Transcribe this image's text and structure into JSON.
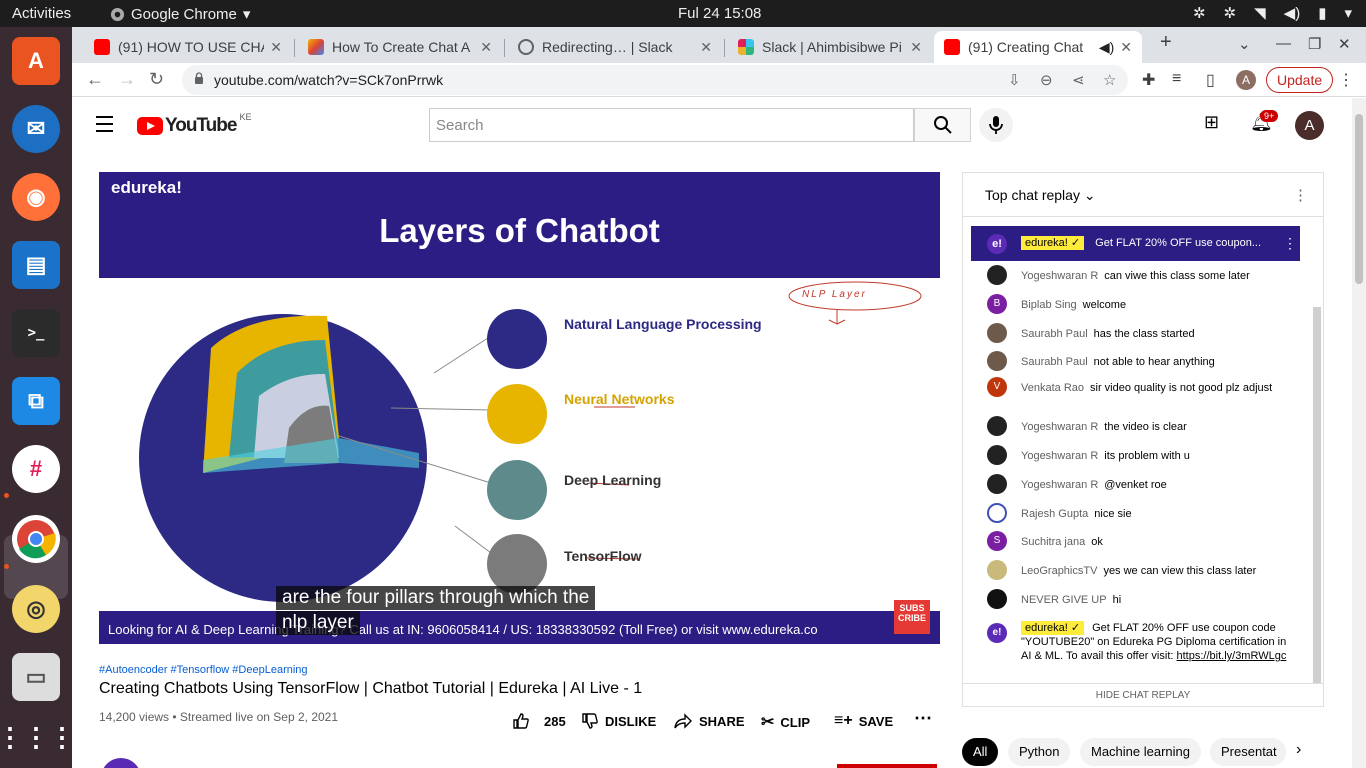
{
  "os": {
    "activities": "Activities",
    "app_name": "Google Chrome",
    "clock": "Ful 24  15:08"
  },
  "tabs": [
    {
      "title": "(91) HOW TO USE CHA",
      "favicon": "youtube"
    },
    {
      "title": "How To Create Chat A",
      "favicon": "colorful"
    },
    {
      "title": "Redirecting… | Slack",
      "favicon": "globe"
    },
    {
      "title": "Slack | Ahimbisibwe Pi",
      "favicon": "slack"
    },
    {
      "title": "(91) Creating Chat",
      "favicon": "youtube",
      "active": true,
      "audio": true
    }
  ],
  "address_bar": {
    "url": "youtube.com/watch?v=SCk7onPrrwk"
  },
  "update_label": "Update",
  "profile_initial": "A",
  "youtube": {
    "logo_text": "YouTube",
    "country": "KE",
    "search_placeholder": "Search",
    "notification_count": "9+",
    "avatar_initial": "A"
  },
  "video": {
    "brand": "edureka!",
    "slide_title": "Layers of Chatbot",
    "layers": [
      {
        "label": "Natural Language Processing",
        "color": "#2c2a84"
      },
      {
        "label": "Neural Networks",
        "color": "#e7b400"
      },
      {
        "label": "Deep Learning",
        "color": "#5f8a8b"
      },
      {
        "label": "TensorFlow",
        "color": "#7b7b7b"
      }
    ],
    "annotation": "NLP Layer",
    "bottom_text": "Looking for AI & Deep Learning Training? Call us at IN: 9606058414 / US: 18338330592 (Toll Free) or visit www.edureka.co",
    "caption_lines": [
      "are the four pillars through which the",
      "nlp layer"
    ],
    "subscribe_label": "SUBS CRIBE"
  },
  "meta": {
    "hashtags": "#Autoencoder #Tensorflow #DeepLearning",
    "title": "Creating Chatbots Using TensorFlow | Chatbot Tutorial | Edureka | AI Live - 1",
    "views": "14,200 views • Streamed live on Sep 2, 2021",
    "likes": "285",
    "dislike": "DISLIKE",
    "share": "SHARE",
    "clip": "CLIP",
    "save": "SAVE"
  },
  "chat": {
    "header": "Top chat replay",
    "pinned": {
      "author": "edureka!",
      "text": "Get FLAT 20% OFF use coupon..."
    },
    "messages": [
      {
        "author": "Yogeshwaran R",
        "text": "can viwe this class some later",
        "avatar": "dark"
      },
      {
        "author": "Biplab Sing",
        "text": "welcome",
        "avatar": "purple",
        "initial": "B"
      },
      {
        "author": "Saurabh Paul",
        "text": "has the class started",
        "avatar": "photo"
      },
      {
        "author": "Saurabh Paul",
        "text": "not able to hear anything",
        "avatar": "photo"
      },
      {
        "author": "Venkata Rao",
        "text": "sir video quality is not good plz adjust",
        "avatar": "orange",
        "initial": "V"
      },
      {
        "author": "Yogeshwaran R",
        "text": "the video is clear",
        "avatar": "dark"
      },
      {
        "author": "Yogeshwaran R",
        "text": "its problem with u",
        "avatar": "dark"
      },
      {
        "author": "Yogeshwaran R",
        "text": "@venket roe",
        "avatar": "dark"
      },
      {
        "author": "Rajesh Gupta",
        "text": "nice sie",
        "avatar": "ring"
      },
      {
        "author": "Suchitra jana",
        "text": "ok",
        "avatar": "purple",
        "initial": "S"
      },
      {
        "author": "LeoGraphicsTV",
        "text": "yes we can view this class later",
        "avatar": "photo2"
      },
      {
        "author": "NEVER GIVE UP",
        "text": "hi",
        "avatar": "black"
      }
    ],
    "promo": {
      "author": "edureka!",
      "text": "Get FLAT 20% OFF use coupon code \"YOUTUBE20\" on Edureka PG Diploma certification in AI & ML. To avail this offer visit: ",
      "link": "https://bit.ly/3mRWLgc"
    },
    "hide_label": "HIDE CHAT REPLAY"
  },
  "chips": [
    "All",
    "Python",
    "Machine learning",
    "Presentat"
  ]
}
